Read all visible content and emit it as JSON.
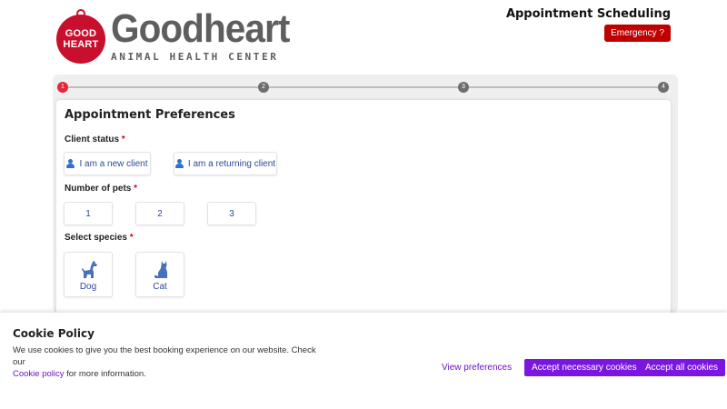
{
  "header": {
    "logo_tag_line1": "GOOD",
    "logo_tag_line2": "HEART",
    "logo_name": "Goodheart",
    "logo_sub": "ANIMAL HEALTH CENTER",
    "page_heading": "Appointment Scheduling",
    "emergency_label": "Emergency ?"
  },
  "stepper": {
    "steps": [
      "1",
      "2",
      "3",
      "4"
    ],
    "active": 1
  },
  "form": {
    "title": "Appointment Preferences",
    "client_status": {
      "label": "Client status",
      "required": "*",
      "options": [
        "I am a new client",
        "I am a returning client"
      ]
    },
    "num_pets": {
      "label": "Number of pets",
      "required": "*",
      "options": [
        "1",
        "2",
        "3"
      ]
    },
    "species": {
      "label": "Select species",
      "required": "*",
      "options": [
        {
          "label": "Dog",
          "icon": "dog-icon"
        },
        {
          "label": "Cat",
          "icon": "cat-icon"
        }
      ]
    }
  },
  "cookie": {
    "title": "Cookie Policy",
    "text_before": "We use cookies to give you the best booking experience on our website. Check our",
    "link_text": "Cookie policy",
    "text_after": " for more information.",
    "view_preferences": "View preferences",
    "accept_necessary": "Accept necessary cookies",
    "accept_all": "Accept all cookies"
  },
  "colors": {
    "brand_red": "#c8102e",
    "emergency_red": "#c00000",
    "accent_purple": "#7b16e0",
    "link_blue": "#2a4a9a"
  }
}
